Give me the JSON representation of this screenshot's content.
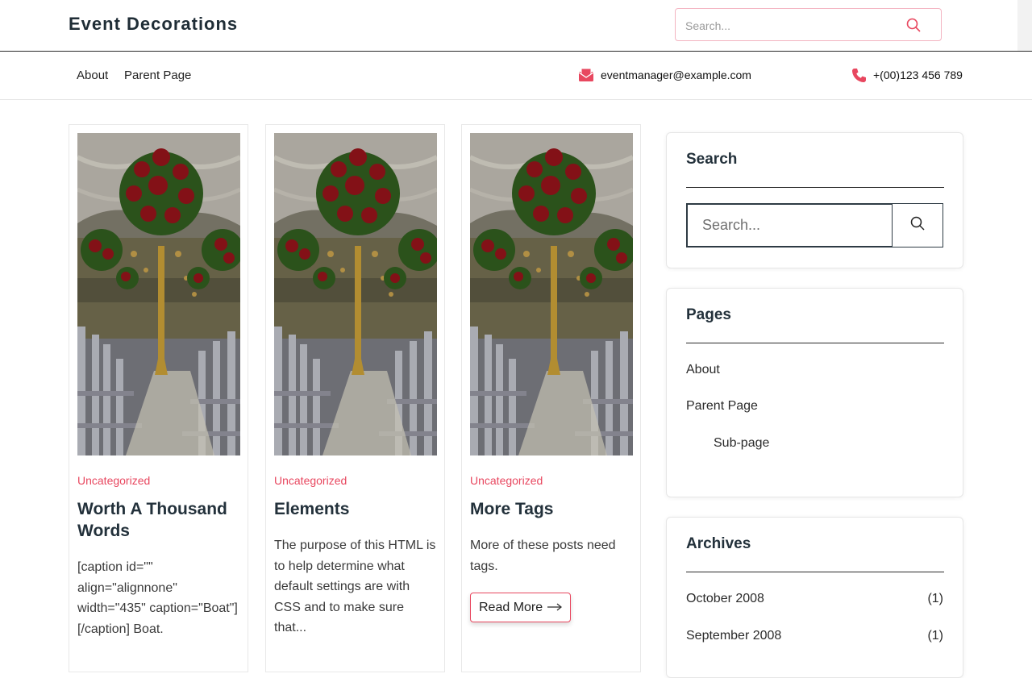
{
  "header": {
    "site_title": "Event Decorations",
    "search_placeholder": "Search..."
  },
  "nav": {
    "links": [
      "About",
      "Parent Page"
    ],
    "email": "eventmanager@example.com",
    "phone": "+(00)123 456 789"
  },
  "posts": [
    {
      "category": "Uncategorized",
      "title": "Worth A Thousand Words",
      "excerpt": "[caption id=\"\" align=\"alignnone\" width=\"435\" caption=\"Boat\"] [/caption] Boat."
    },
    {
      "category": "Uncategorized",
      "title": "Elements",
      "excerpt": "The purpose of this HTML is to help determine what default settings are with CSS and to make sure that..."
    },
    {
      "category": "Uncategorized",
      "title": "More Tags",
      "excerpt": "More of these posts need tags.",
      "read_more": "Read More"
    }
  ],
  "sidebar": {
    "search": {
      "title": "Search",
      "placeholder": "Search..."
    },
    "pages": {
      "title": "Pages",
      "items": [
        "About",
        "Parent Page",
        "Sub-page"
      ]
    },
    "archives": {
      "title": "Archives",
      "items": [
        {
          "label": "October 2008",
          "count": "(1)"
        },
        {
          "label": "September 2008",
          "count": "(1)"
        }
      ]
    }
  },
  "colors": {
    "accent": "#e8475f",
    "heading": "#23313b"
  }
}
